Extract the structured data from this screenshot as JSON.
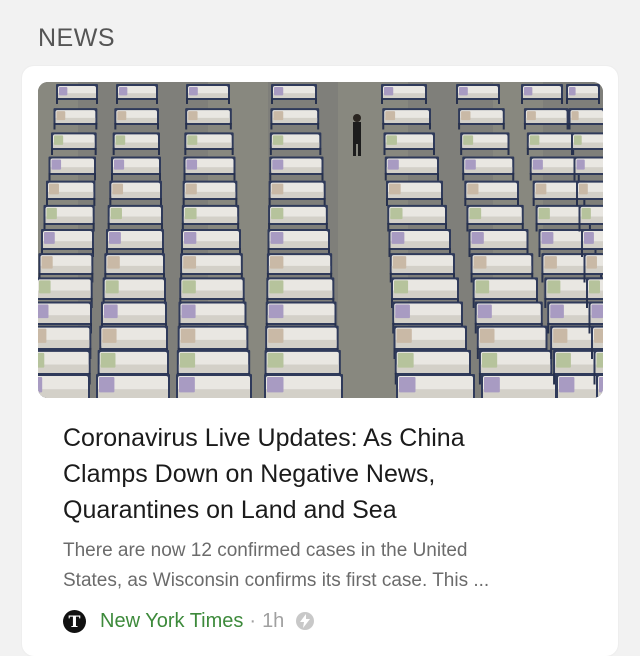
{
  "section": {
    "title": "NEWS"
  },
  "article": {
    "headline_lines": [
      "Coronavirus Live Updates: As China",
      "Clamps Down on Negative News,",
      "Quarantines on Land and Sea"
    ],
    "snippet_lines": [
      "There are now 12 confirmed cases in the United",
      "States, as Wisconsin confirms its first case. This ..."
    ],
    "image_icon": "photo-of-rows-of-beds",
    "source": {
      "logo_letter": "T",
      "name": "New York Times",
      "separator": "·",
      "age": "1h",
      "badge_icon": "lightning-bolt-icon"
    }
  },
  "colors": {
    "source_green": "#3d8a3b",
    "meta_gray": "#a0a0a0",
    "background": "#f2f2f2",
    "card": "#ffffff"
  }
}
